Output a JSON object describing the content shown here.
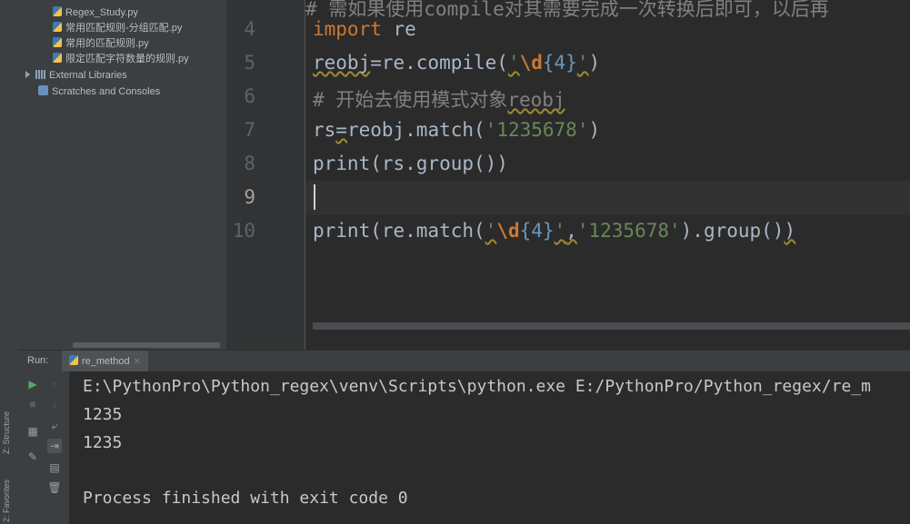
{
  "side_tabs": {
    "structure": "Z: Structure",
    "favorites": "2: Favorites"
  },
  "project_tree": {
    "items": [
      {
        "label": "Regex_Study.py",
        "icon": "python-file-icon"
      },
      {
        "label": "常用匹配规则-分组匹配.py",
        "icon": "python-file-icon"
      },
      {
        "label": "常用的匹配规则.py",
        "icon": "python-file-icon"
      },
      {
        "label": "限定匹配字符数量的规则.py",
        "icon": "python-file-icon"
      }
    ],
    "external_libraries": "External Libraries",
    "scratches": "Scratches and Consoles"
  },
  "editor": {
    "top_partial_line": "# 需如果使用compile对其需要完成一次转换后即可，以后再",
    "lines": [
      {
        "num": "4"
      },
      {
        "num": "5"
      },
      {
        "num": "6"
      },
      {
        "num": "7"
      },
      {
        "num": "8"
      },
      {
        "num": "9"
      },
      {
        "num": "10"
      }
    ],
    "code": {
      "l4_kw": "import",
      "l4_rest": " re",
      "l5_a": "reobj",
      "l5_b": "=re.compile(",
      "l5_q1": "'",
      "l5_esc": "\\d",
      "l5_num": "{4}",
      "l5_q2": "'",
      "l5_c": ")",
      "l6_cmt": "# 开始去使用模式对象",
      "l6_word": "reobj",
      "l7_a": "rs",
      "l7_b": "=",
      "l7_c": "reobj.match(",
      "l7_str": "'1235678'",
      "l7_d": ")",
      "l8": "print(rs.group())",
      "l10_a": "print(re.match(",
      "l10_q1": "'",
      "l10_esc": "\\d",
      "l10_num": "{4}",
      "l10_q2": "'",
      "l10_comma": ",",
      "l10_str": "'1235678'",
      "l10_b": ").group()",
      "l10_c": ")"
    }
  },
  "run_panel": {
    "label": "Run:",
    "tab": "re_method",
    "output": [
      "E:\\PythonPro\\Python_regex\\venv\\Scripts\\python.exe E:/PythonPro/Python_regex/re_m",
      "1235",
      "1235",
      "",
      "Process finished with exit code 0"
    ]
  }
}
